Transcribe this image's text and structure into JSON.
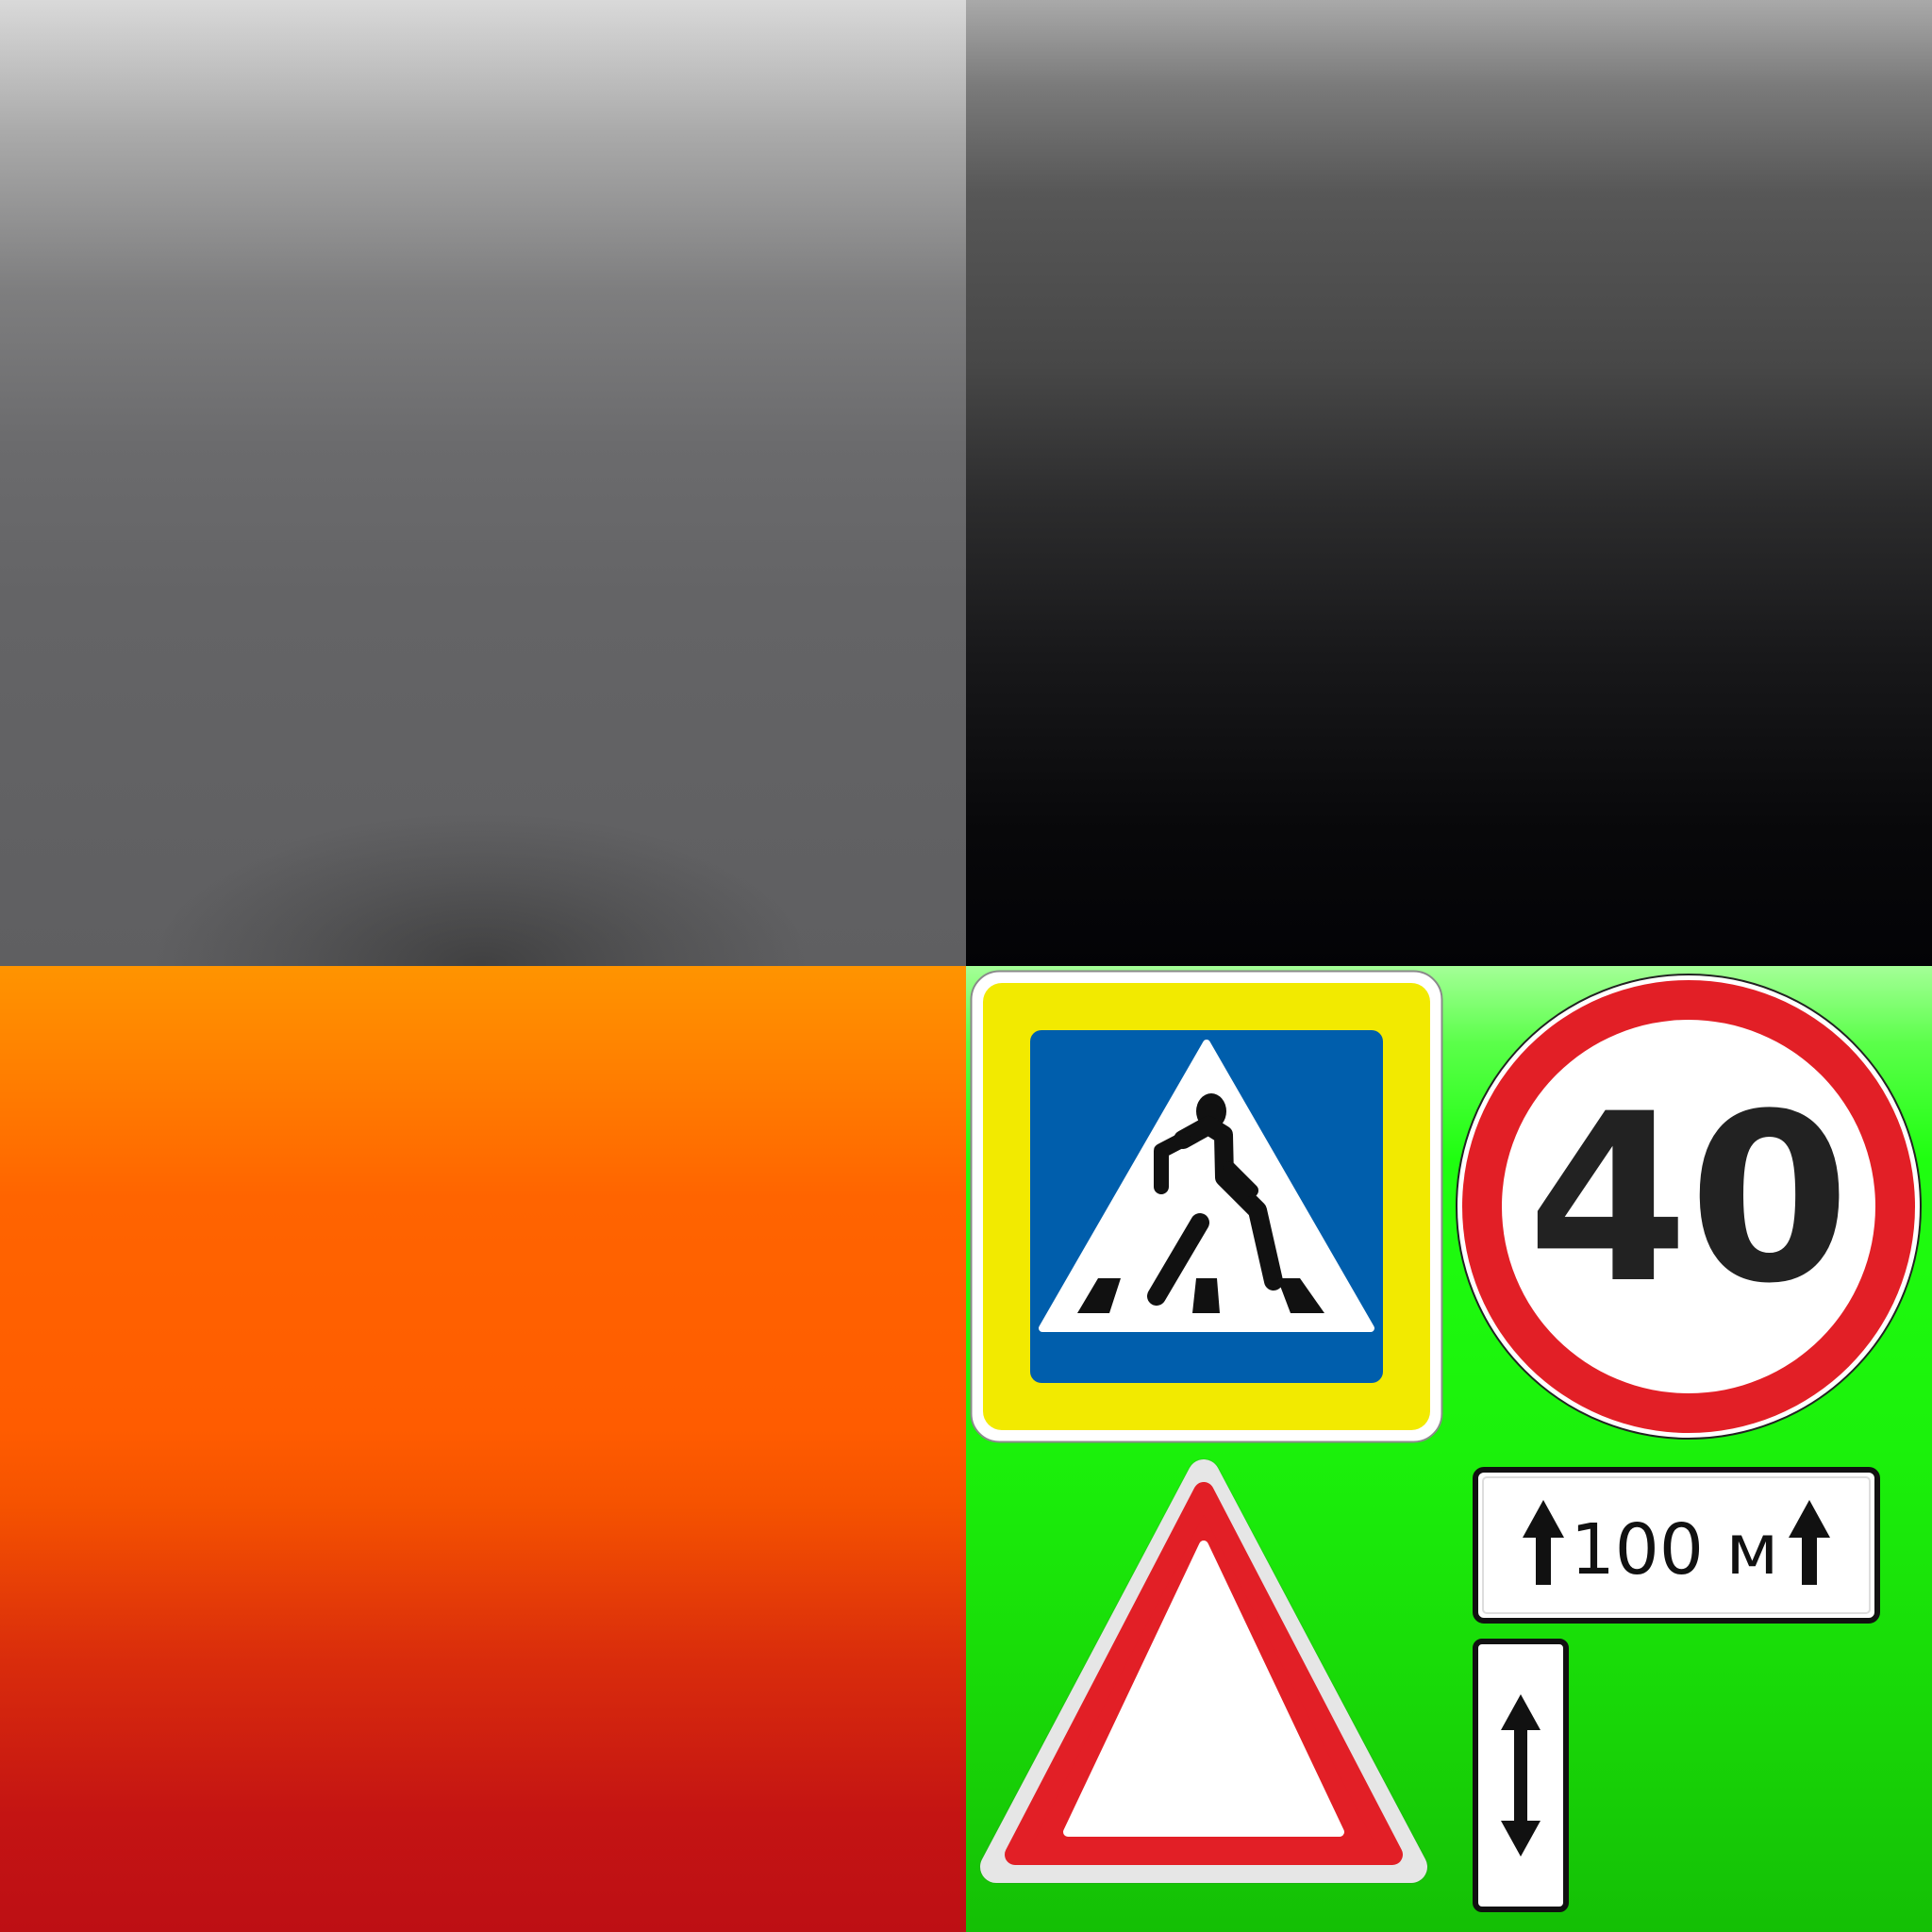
{
  "quadrants": {
    "top_left": {
      "description_color_top": "#d9d9d9",
      "description_color_bottom": "#5f5f61"
    },
    "top_right": {
      "description_color_top": "#a9a9a9",
      "description_color_bottom": "#030306"
    },
    "bottom_left": {
      "description_color_top": "#ff9400",
      "description_color_bottom": "#bd0f14"
    },
    "bottom_right": {
      "description_color_top": "#a4ff97",
      "description_color_bottom": "#14bf05"
    }
  },
  "signs": {
    "pedestrian_crossing": {
      "icon": "pedestrian-crossing-icon",
      "frame_color": "#f2ea00",
      "field_color": "#005eac"
    },
    "speed_limit": {
      "value": "40",
      "ring_color": "#e21f26"
    },
    "warning_triangle": {
      "border_color": "#e21f26"
    },
    "distance_plate": {
      "text": "100 м"
    },
    "vertical_extent_plate": {
      "icon": "double-vertical-arrow-icon"
    }
  }
}
